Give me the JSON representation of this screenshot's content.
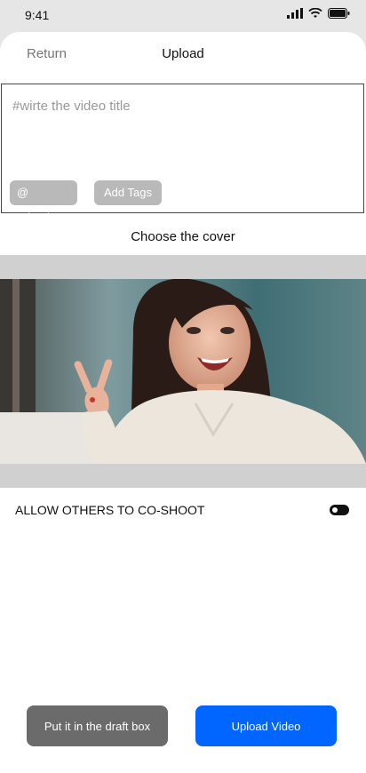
{
  "status_bar": {
    "time": "9:41"
  },
  "header": {
    "return_label": "Return",
    "title": "Upload"
  },
  "editor": {
    "placeholder": "#wirte the video title",
    "friends_chip": "@ Friends",
    "tags_chip": "Add Tags"
  },
  "cover": {
    "label": "Choose the cover"
  },
  "co_shoot": {
    "label": "ALLOW OTHERS TO CO-SHOOT"
  },
  "actions": {
    "draft_label": "Put it in the draft box",
    "upload_label": "Upload Video",
    "upload_color": "#0066ff"
  }
}
